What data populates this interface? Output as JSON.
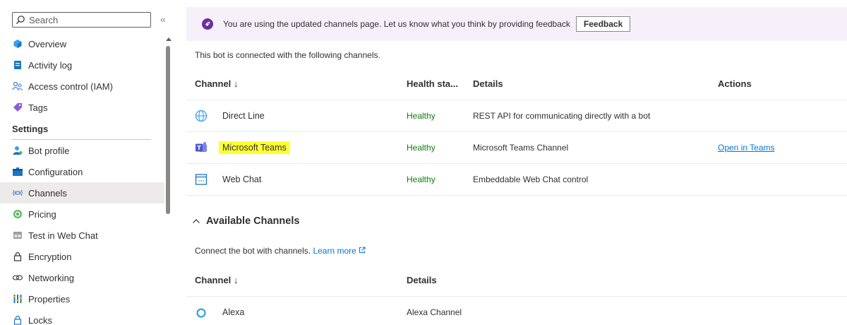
{
  "sidebar": {
    "search_placeholder": "Search",
    "collapse_glyph": "«",
    "items_top": [
      {
        "label": "Overview",
        "icon": "overview-icon"
      },
      {
        "label": "Activity log",
        "icon": "activity-log-icon"
      },
      {
        "label": "Access control (IAM)",
        "icon": "access-control-icon"
      },
      {
        "label": "Tags",
        "icon": "tag-icon"
      }
    ],
    "settings_header": "Settings",
    "items_settings": [
      {
        "label": "Bot profile",
        "icon": "bot-profile-icon"
      },
      {
        "label": "Configuration",
        "icon": "configuration-icon"
      },
      {
        "label": "Channels",
        "icon": "channels-icon",
        "active": true
      },
      {
        "label": "Pricing",
        "icon": "pricing-icon"
      },
      {
        "label": "Test in Web Chat",
        "icon": "test-web-chat-icon"
      },
      {
        "label": "Encryption",
        "icon": "lock-icon"
      },
      {
        "label": "Networking",
        "icon": "networking-icon"
      },
      {
        "label": "Properties",
        "icon": "properties-icon"
      },
      {
        "label": "Locks",
        "icon": "lock-icon"
      }
    ]
  },
  "banner": {
    "text": "You are using the updated channels page. Let us know what you think by providing feedback",
    "button": "Feedback"
  },
  "connected": {
    "intro": "This bot is connected with the following channels.",
    "columns": [
      "Channel ↓",
      "Health sta...",
      "Details",
      "Actions"
    ],
    "rows": [
      {
        "name": "Direct Line",
        "health": "Healthy",
        "details": "REST API for communicating directly with a bot",
        "action": "",
        "icon": "globe-icon"
      },
      {
        "name": "Microsoft Teams",
        "health": "Healthy",
        "details": "Microsoft Teams Channel",
        "action": "Open in Teams",
        "icon": "teams-icon"
      },
      {
        "name": "Web Chat",
        "health": "Healthy",
        "details": "Embeddable Web Chat control",
        "action": "",
        "icon": "web-chat-icon"
      }
    ]
  },
  "available": {
    "heading": "Available Channels",
    "connect_text": "Connect the bot with channels.",
    "learn_more": "Learn more",
    "columns": [
      "Channel ↓",
      "Details"
    ],
    "rows": [
      {
        "name": "Alexa",
        "details": "Alexa Channel",
        "icon": "alexa-icon"
      }
    ]
  },
  "colors": {
    "accent": "#0078d4",
    "healthy": "#107c10",
    "highlight": "#ffff33",
    "banner_bg": "#f5f0fa",
    "banner_icon": "#6b2fa0"
  }
}
